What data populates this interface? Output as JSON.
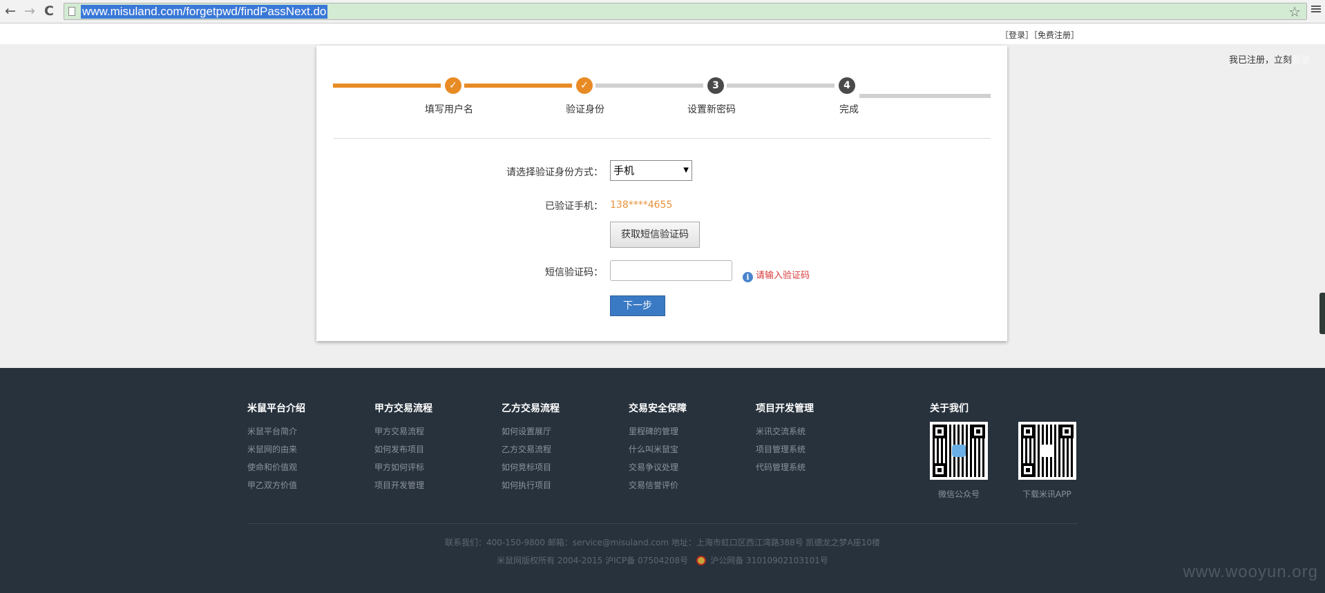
{
  "browser": {
    "url": "www.misuland.com/forgetpwd/findPassNext.do",
    "back_icon": "←",
    "forward_icon": "→",
    "reload_icon": "C",
    "star_icon": "☆"
  },
  "topbar": {
    "login": "［登录］",
    "register": "［免费注册］"
  },
  "side_note": {
    "text": "我已注册，立刻",
    "faint": "登录"
  },
  "steps": [
    {
      "label": "填写用户名",
      "state": "done",
      "marker": "✓"
    },
    {
      "label": "验证身份",
      "state": "done",
      "marker": "✓"
    },
    {
      "label": "设置新密码",
      "state": "todo",
      "marker": "3"
    },
    {
      "label": "完成",
      "state": "todo",
      "marker": "4"
    }
  ],
  "form": {
    "method_label": "请选择验证身份方式：",
    "method_value": "手机",
    "method_arrow": "▼",
    "phone_label": "已验证手机：",
    "phone_value": "138****4655",
    "sms_button": "获取短信验证码",
    "code_label": "短信验证码：",
    "code_value": "",
    "hint_icon": "i",
    "hint_text": "请输入验证码",
    "next_button": "下一步"
  },
  "colors": {
    "accent_orange": "#e88b25",
    "button_blue": "#3a79c3",
    "footer_bg": "#28323d",
    "hint_red": "#d9393a"
  },
  "footer": {
    "columns": [
      {
        "title": "米鼠平台介绍",
        "links": [
          "米鼠平台简介",
          "米鼠网的由来",
          "使命和价值观",
          "甲乙双方价值"
        ]
      },
      {
        "title": "甲方交易流程",
        "links": [
          "甲方交易流程",
          "如何发布项目",
          "甲方如何评标",
          "项目开发管理"
        ]
      },
      {
        "title": "乙方交易流程",
        "links": [
          "如何设置展厅",
          "乙方交易流程",
          "如何竞标项目",
          "如何执行项目"
        ]
      },
      {
        "title": "交易安全保障",
        "links": [
          "里程碑的管理",
          "什么叫米鼠宝",
          "交易争议处理",
          "交易信誉评价"
        ]
      },
      {
        "title": "项目开发管理",
        "links": [
          "米讯交流系统",
          "项目管理系统",
          "代码管理系统"
        ]
      }
    ],
    "about": {
      "title": "关于我们",
      "qr_captions": [
        "微信公众号",
        "下载米讯APP"
      ]
    },
    "contact": "联系我们：400-150-9800 邮箱：service@misuland.com 地址：上海市虹口区西江湾路388号 凯德龙之梦A座10楼",
    "copyright": "米鼠网版权所有 2004-2015 沪ICP备 07504208号",
    "police": "沪公网备 31010902103101号"
  },
  "watermark": "www.wooyun.org"
}
